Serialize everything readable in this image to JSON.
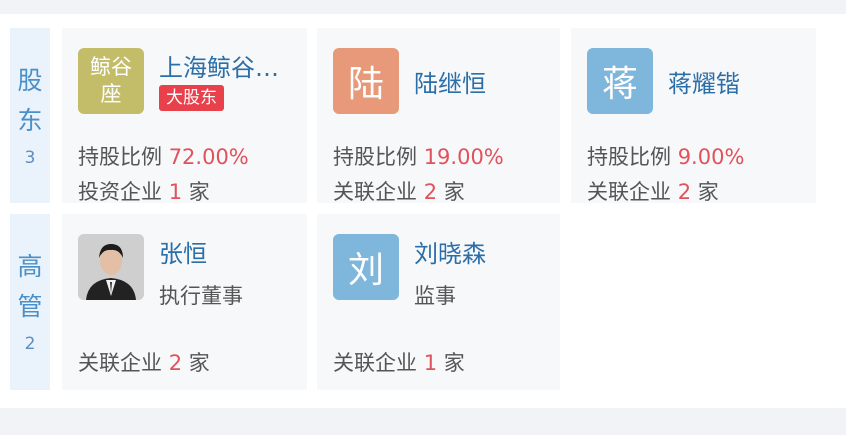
{
  "sections": [
    {
      "chars": [
        "股",
        "东"
      ],
      "count": "3"
    },
    {
      "chars": [
        "高",
        "管"
      ],
      "count": "2"
    }
  ],
  "shareholders": [
    {
      "avatar_lines": [
        "鲸谷",
        "座"
      ],
      "avatar_color": "#c3bd6a",
      "name": "上海鲸谷…",
      "badge": "大股东",
      "ratio_label": "持股比例",
      "ratio": "72.00%",
      "invest_label": "投资企业",
      "invest_count": "1",
      "unit": "家"
    },
    {
      "avatar_char": "陆",
      "avatar_color": "#e7997a",
      "name": "陆继恒",
      "ratio_label": "持股比例",
      "ratio": "19.00%",
      "invest_label": "关联企业",
      "invest_count": "2",
      "unit": "家"
    },
    {
      "avatar_char": "蒋",
      "avatar_color": "#7eb6dc",
      "name": "蒋耀锴",
      "ratio_label": "持股比例",
      "ratio": "9.00%",
      "invest_label": "关联企业",
      "invest_count": "2",
      "unit": "家"
    }
  ],
  "executives": [
    {
      "name": "张恒",
      "role": "执行董事",
      "assoc_label": "关联企业",
      "assoc_count": "2",
      "unit": "家"
    },
    {
      "avatar_char": "刘",
      "avatar_color": "#7eb6dc",
      "name": "刘晓森",
      "role": "监事",
      "assoc_label": "关联企业",
      "assoc_count": "1",
      "unit": "家"
    }
  ]
}
